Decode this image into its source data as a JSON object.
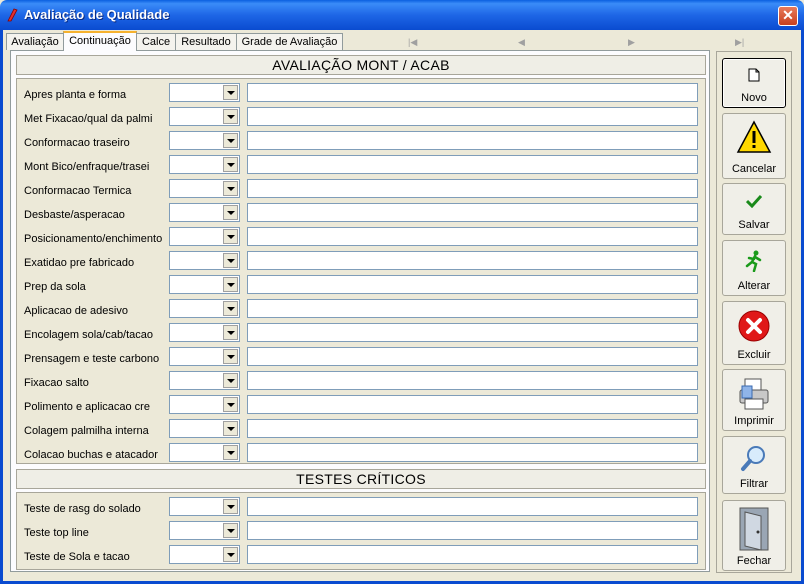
{
  "window": {
    "title": "Avaliação de Qualidade"
  },
  "tabs": [
    "Avaliação",
    "Continuação",
    "Calce",
    "Resultado",
    "Grade de Avaliação"
  ],
  "active_tab": "Continuação",
  "sections": {
    "montagem": {
      "title": "AVALIAÇÃO MONT / ACAB",
      "rows": [
        "Apres planta e forma",
        "Met Fixacao/qual da palmi",
        "Conformacao traseiro",
        "Mont Bico/enfraque/trasei",
        "Conformacao Termica",
        "Desbaste/asperacao",
        "Posicionamento/enchimento",
        "Exatidao pre fabricado",
        "Prep da sola",
        "Aplicacao de adesivo",
        "Encolagem sola/cab/tacao",
        "Prensagem e teste carbono",
        "Fixacao salto",
        "Polimento e aplicacao cre",
        "Colagem palmilha interna",
        "Colacao buchas e atacador"
      ]
    },
    "testes": {
      "title": "TESTES CRÍTICOS",
      "rows": [
        "Teste de rasg do solado",
        "Teste top line",
        "Teste de Sola e tacao"
      ]
    }
  },
  "sidebar": {
    "buttons": [
      "Novo",
      "Cancelar",
      "Salvar",
      "Alterar",
      "Excluir",
      "Imprimir",
      "Filtrar",
      "Fechar"
    ]
  },
  "colors": {
    "title_bar": "#0A5FE0",
    "window_bg": "#ECE9D8",
    "close_button": "#D8522E",
    "tab_highlight": "#F6B22E"
  }
}
